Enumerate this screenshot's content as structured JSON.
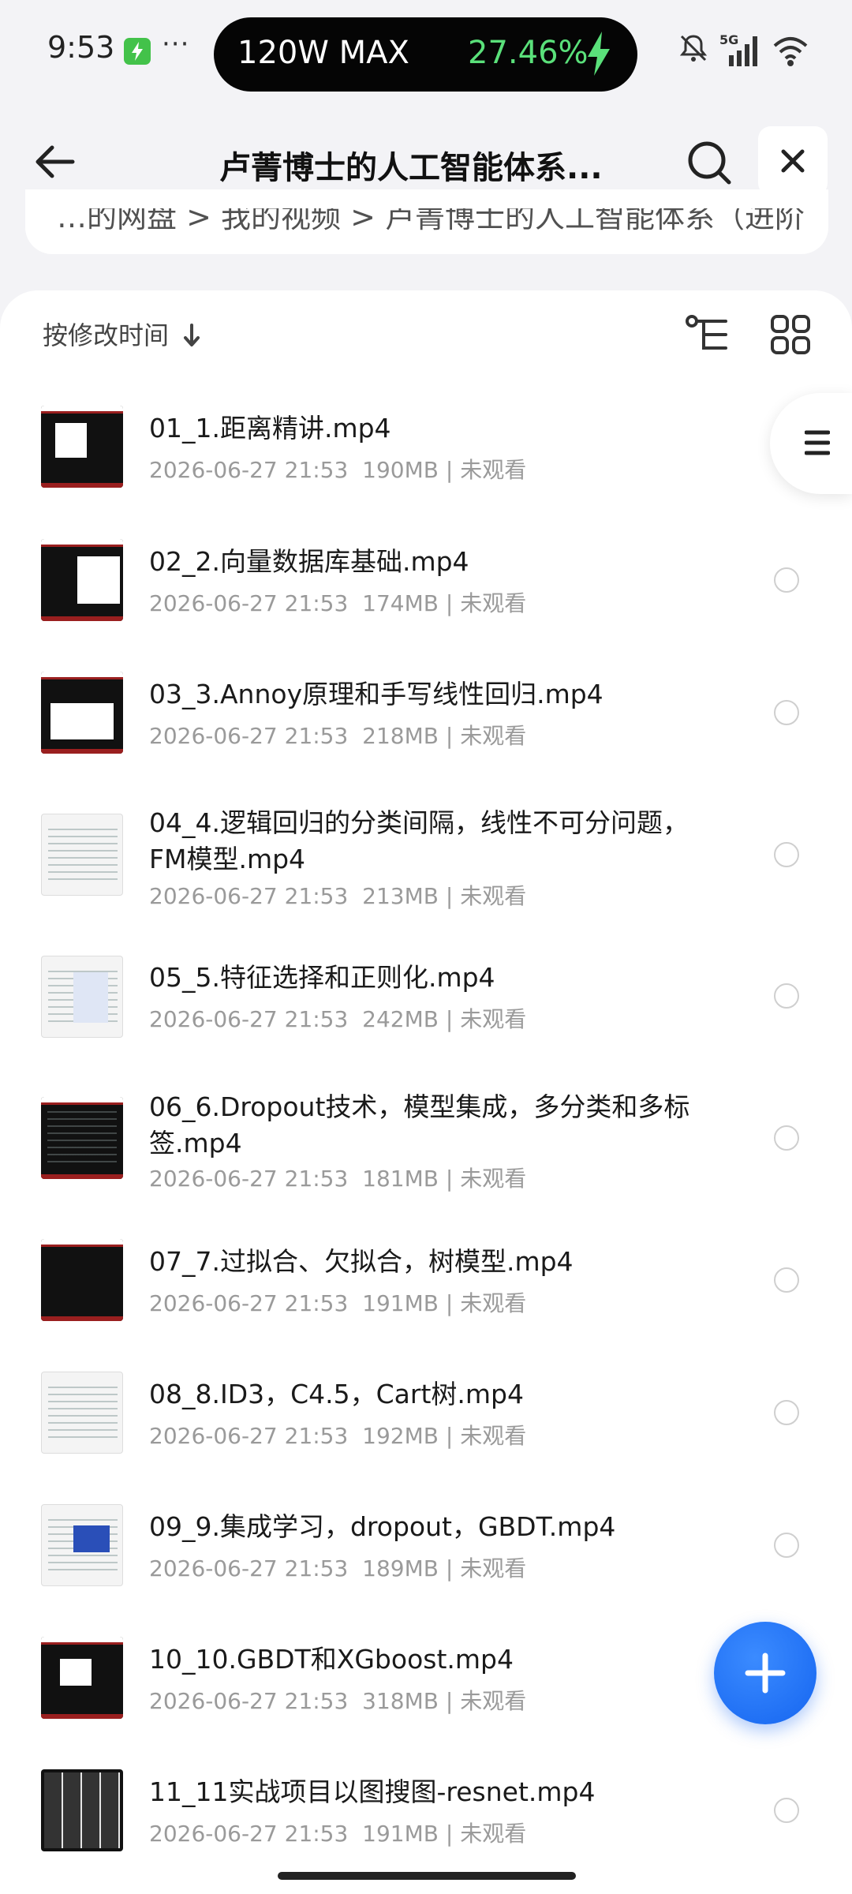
{
  "status_bar": {
    "time": "9:53",
    "dots": "···",
    "charge_label": "120W MAX",
    "charge_percent": "27.46%",
    "icons": [
      "battery-charging-icon",
      "mute-icon",
      "signal-5g-icon",
      "wifi-icon"
    ]
  },
  "header": {
    "title": "卢菁博士的人工智能体系..."
  },
  "breadcrumb": {
    "text": "…的网盘  >  我的视频  >  卢菁博士的人工智能体系（进阶"
  },
  "toolbar": {
    "sort_label": "按修改时间"
  },
  "files": [
    {
      "name": "01_1.距离精讲.mp4",
      "date": "2026-06-27 21:53",
      "size": "190MB",
      "status": "未观看"
    },
    {
      "name": "02_2.向量数据库基础.mp4",
      "date": "2026-06-27 21:53",
      "size": "174MB",
      "status": "未观看"
    },
    {
      "name": "03_3.Annoy原理和手写线性回归.mp4",
      "date": "2026-06-27 21:53",
      "size": "218MB",
      "status": "未观看"
    },
    {
      "name": "04_4.逻辑回归的分类间隔，线性不可分问题，FM模型.mp4",
      "date": "2026-06-27 21:53",
      "size": "213MB",
      "status": "未观看"
    },
    {
      "name": "05_5.特征选择和正则化.mp4",
      "date": "2026-06-27 21:53",
      "size": "242MB",
      "status": "未观看"
    },
    {
      "name": "06_6.Dropout技术，模型集成，多分类和多标签.mp4",
      "date": "2026-06-27 21:53",
      "size": "181MB",
      "status": "未观看"
    },
    {
      "name": "07_7.过拟合、欠拟合，树模型.mp4",
      "date": "2026-06-27 21:53",
      "size": "191MB",
      "status": "未观看"
    },
    {
      "name": "08_8.ID3，C4.5，Cart树.mp4",
      "date": "2026-06-27 21:53",
      "size": "192MB",
      "status": "未观看"
    },
    {
      "name": "09_9.集成学习，dropout，GBDT.mp4",
      "date": "2026-06-27 21:53",
      "size": "189MB",
      "status": "未观看"
    },
    {
      "name": "10_10.GBDT和XGboost.mp4",
      "date": "2026-06-27 21:53",
      "size": "318MB",
      "status": "未观看"
    },
    {
      "name": "11_11实战项目以图搜图-resnet.mp4",
      "date": "2026-06-27 21:53",
      "size": "191MB",
      "status": "未观看"
    }
  ],
  "colors": {
    "accent": "#1565f0",
    "charge_green": "#5ae07a",
    "meta_gray": "#9a9a9a",
    "background": "#f3f3f6"
  }
}
